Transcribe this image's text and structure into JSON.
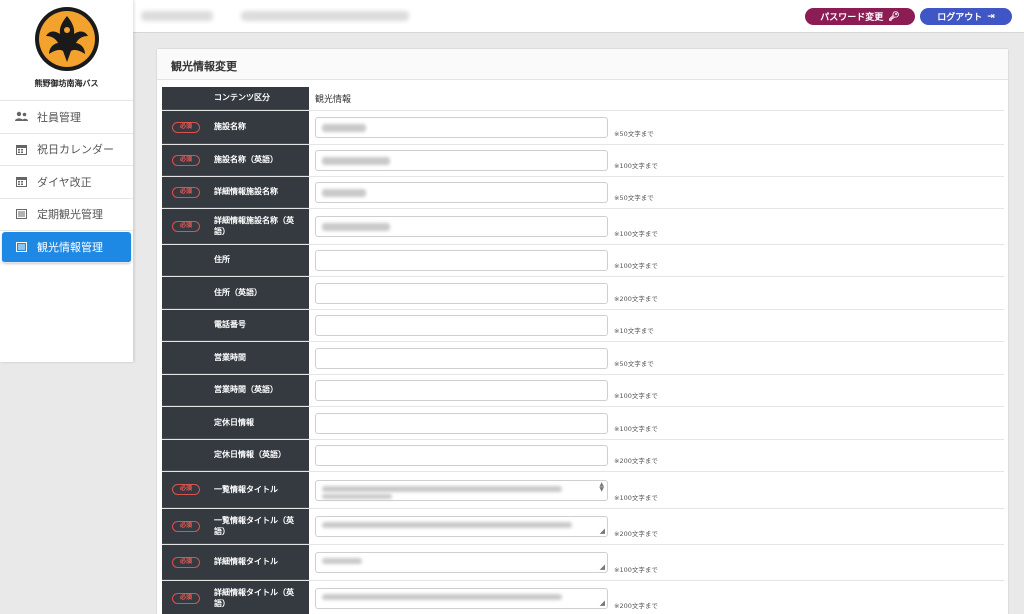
{
  "brand": {
    "name": "熊野御坊南海バス"
  },
  "sidebar": {
    "items": [
      {
        "label": "社員管理",
        "icon": "users-icon"
      },
      {
        "label": "祝日カレンダー",
        "icon": "calendar-icon"
      },
      {
        "label": "ダイヤ改正",
        "icon": "calendar-icon"
      },
      {
        "label": "定期観光管理",
        "icon": "list-icon"
      },
      {
        "label": "観光情報管理",
        "icon": "list-icon",
        "active": true
      }
    ]
  },
  "topbar": {
    "password_label": "パスワード変更",
    "logout_label": "ログアウト"
  },
  "card": {
    "title": "観光情報変更"
  },
  "form": {
    "required_label": "必須",
    "rows": [
      {
        "label": "コンテンツ区分",
        "value": "観光情報"
      },
      {
        "label": "施設名称",
        "hint": "※50文字まで"
      },
      {
        "label": "施設名称（英語）",
        "hint": "※100文字まで"
      },
      {
        "label": "詳細情報施設名称",
        "hint": "※50文字まで"
      },
      {
        "label": "詳細情報施設名称（英語）",
        "hint": "※100文字まで"
      },
      {
        "label": "住所",
        "hint": "※100文字まで"
      },
      {
        "label": "住所（英語）",
        "hint": "※200文字まで"
      },
      {
        "label": "電話番号",
        "hint": "※10文字まで"
      },
      {
        "label": "営業時間",
        "hint": "※50文字まで"
      },
      {
        "label": "営業時間（英語）",
        "hint": "※100文字まで"
      },
      {
        "label": "定休日情報",
        "hint": "※100文字まで"
      },
      {
        "label": "定休日情報（英語）",
        "hint": "※200文字まで"
      },
      {
        "label": "一覧情報タイトル",
        "hint": "※100文字まで"
      },
      {
        "label": "一覧情報タイトル（英語）",
        "hint": "※200文字まで"
      },
      {
        "label": "詳細情報タイトル",
        "hint": "※100文字まで"
      },
      {
        "label": "詳細情報タイトル（英語）",
        "hint": "※200文字まで"
      }
    ]
  },
  "colors": {
    "accent": "#1e88e5",
    "password_button": "#8b1c54",
    "logout_button": "#3f56c4",
    "label_bg": "#343a40",
    "required": "#d9534f"
  }
}
